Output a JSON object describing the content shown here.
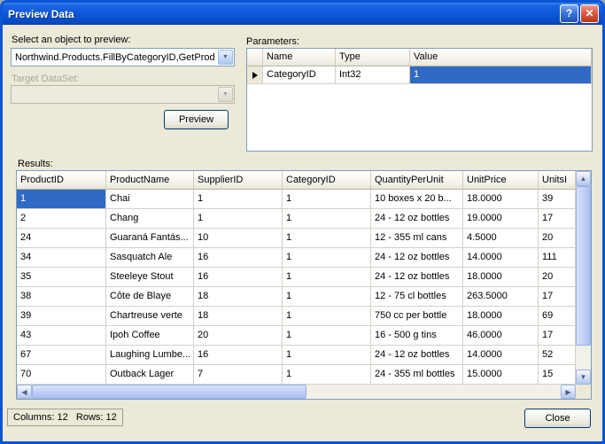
{
  "window": {
    "title": "Preview Data"
  },
  "icons": {
    "help": "?",
    "close": "✕",
    "dropdown": "▼",
    "up": "▲",
    "down": "▼",
    "left": "◀",
    "right": "▶"
  },
  "picker": {
    "label": "Select an object to preview:",
    "value": "Northwind.Products.FillByCategoryID,GetProd",
    "target_label": "Target DataSet:",
    "target_value": "",
    "preview_button": "Preview"
  },
  "parameters": {
    "label": "Parameters:",
    "columns": [
      "Name",
      "Type",
      "Value"
    ],
    "rows": [
      {
        "name": "CategoryID",
        "type": "Int32",
        "value": "1"
      }
    ]
  },
  "results": {
    "label": "Results:",
    "columns": [
      "ProductID",
      "ProductName",
      "SupplierID",
      "CategoryID",
      "QuantityPerUnit",
      "UnitPrice",
      "UnitsI"
    ],
    "rows": [
      [
        "1",
        "Chai",
        "1",
        "1",
        "10 boxes x 20 b...",
        "18.0000",
        "39"
      ],
      [
        "2",
        "Chang",
        "1",
        "1",
        "24 - 12 oz bottles",
        "19.0000",
        "17"
      ],
      [
        "24",
        "Guaraná Fantás...",
        "10",
        "1",
        "12 - 355 ml cans",
        "4.5000",
        "20"
      ],
      [
        "34",
        "Sasquatch Ale",
        "16",
        "1",
        "24 - 12 oz bottles",
        "14.0000",
        "111"
      ],
      [
        "35",
        "Steeleye Stout",
        "16",
        "1",
        "24 - 12 oz bottles",
        "18.0000",
        "20"
      ],
      [
        "38",
        "Côte de Blaye",
        "18",
        "1",
        "12 - 75 cl bottles",
        "263.5000",
        "17"
      ],
      [
        "39",
        "Chartreuse verte",
        "18",
        "1",
        "750 cc per bottle",
        "18.0000",
        "69"
      ],
      [
        "43",
        "Ipoh Coffee",
        "20",
        "1",
        "16 - 500 g tins",
        "46.0000",
        "17"
      ],
      [
        "67",
        "Laughing Lumbe...",
        "16",
        "1",
        "24 - 12 oz bottles",
        "14.0000",
        "52"
      ],
      [
        "70",
        "Outback Lager",
        "7",
        "1",
        "24 - 355 ml bottles",
        "15.0000",
        "15"
      ]
    ]
  },
  "statusbar": {
    "summary": "Columns: 12   Rows: 12"
  },
  "footer": {
    "close_button": "Close"
  }
}
